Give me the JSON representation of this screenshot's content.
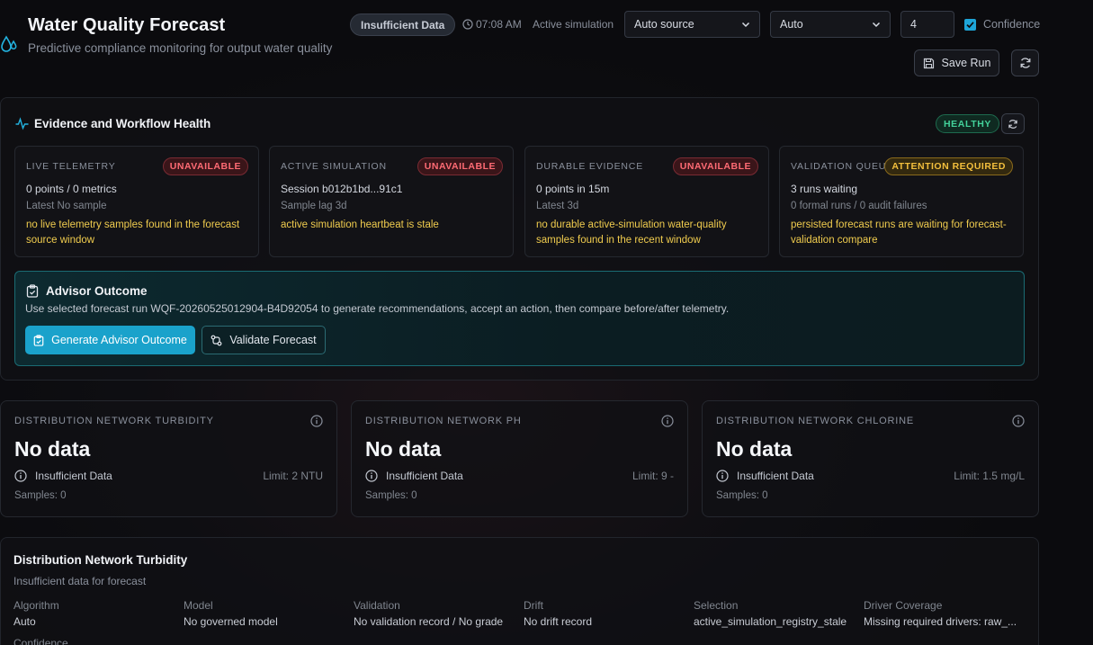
{
  "header": {
    "title": "Water Quality Forecast",
    "subtitle": "Predictive compliance monitoring for output water quality",
    "status_pill": "Insufficient Data",
    "time": "07:08 AM",
    "mode": "Active simulation",
    "source_select": "Auto source",
    "algorithm_select": "Auto",
    "horizon_value": "4",
    "confidence_label": "Confidence",
    "confidence_checked": true,
    "save_label": "Save Run"
  },
  "evidence": {
    "title": "Evidence and Workflow Health",
    "health_badge": "HEALTHY",
    "cards": [
      {
        "label": "LIVE TELEMETRY",
        "badge": "UNAVAILABLE",
        "primary": "0 points / 0 metrics",
        "secondary": "Latest No sample",
        "warning": "no live telemetry samples found in the forecast source window"
      },
      {
        "label": "ACTIVE SIMULATION",
        "badge": "UNAVAILABLE",
        "primary": "Session b012b1bd...91c1",
        "secondary": "Sample lag 3d",
        "warning": "active simulation heartbeat is stale"
      },
      {
        "label": "DURABLE EVIDENCE",
        "badge": "UNAVAILABLE",
        "primary": "0 points in 15m",
        "secondary": "Latest 3d",
        "warning": "no durable active-simulation water-quality samples found in the recent window"
      },
      {
        "label": "VALIDATION QUEUE",
        "badge": "ATTENTION REQUIRED",
        "primary": "3 runs waiting",
        "secondary": "0 formal runs / 0 audit failures",
        "warning": "persisted forecast runs are waiting for forecast-validation compare"
      }
    ]
  },
  "advisor": {
    "title": "Advisor Outcome",
    "description": "Use selected forecast run WQF-20260525012904-B4D92054 to generate recommendations, accept an action, then compare before/after telemetry.",
    "generate_label": "Generate Advisor Outcome",
    "validate_label": "Validate Forecast"
  },
  "metrics": [
    {
      "label": "DISTRIBUTION NETWORK TURBIDITY",
      "value": "No data",
      "status": "Insufficient Data",
      "limit": "Limit: 2 NTU",
      "samples": "Samples: 0"
    },
    {
      "label": "DISTRIBUTION NETWORK PH",
      "value": "No data",
      "status": "Insufficient Data",
      "limit": "Limit: 9 -",
      "samples": "Samples: 0"
    },
    {
      "label": "DISTRIBUTION NETWORK CHLORINE",
      "value": "No data",
      "status": "Insufficient Data",
      "limit": "Limit: 1.5 mg/L",
      "samples": "Samples: 0"
    }
  ],
  "forecast": {
    "title": "Distribution Network Turbidity",
    "subtitle": "Insufficient data for forecast",
    "fields": [
      {
        "key": "Algorithm",
        "value": "Auto"
      },
      {
        "key": "Model",
        "value": "No governed model"
      },
      {
        "key": "Validation",
        "value": "No validation record / No grade"
      },
      {
        "key": "Drift",
        "value": "No drift record"
      },
      {
        "key": "Selection",
        "value": "active_simulation_registry_stale"
      },
      {
        "key": "Driver Coverage",
        "value": "Missing required drivers: raw_..."
      }
    ],
    "confidence_label": "Confidence"
  },
  "colors": {
    "accent": "#1aa2cb",
    "healthy": "#43d19a",
    "unavailable": "#ff6b74",
    "attention": "#f3bf3d"
  }
}
